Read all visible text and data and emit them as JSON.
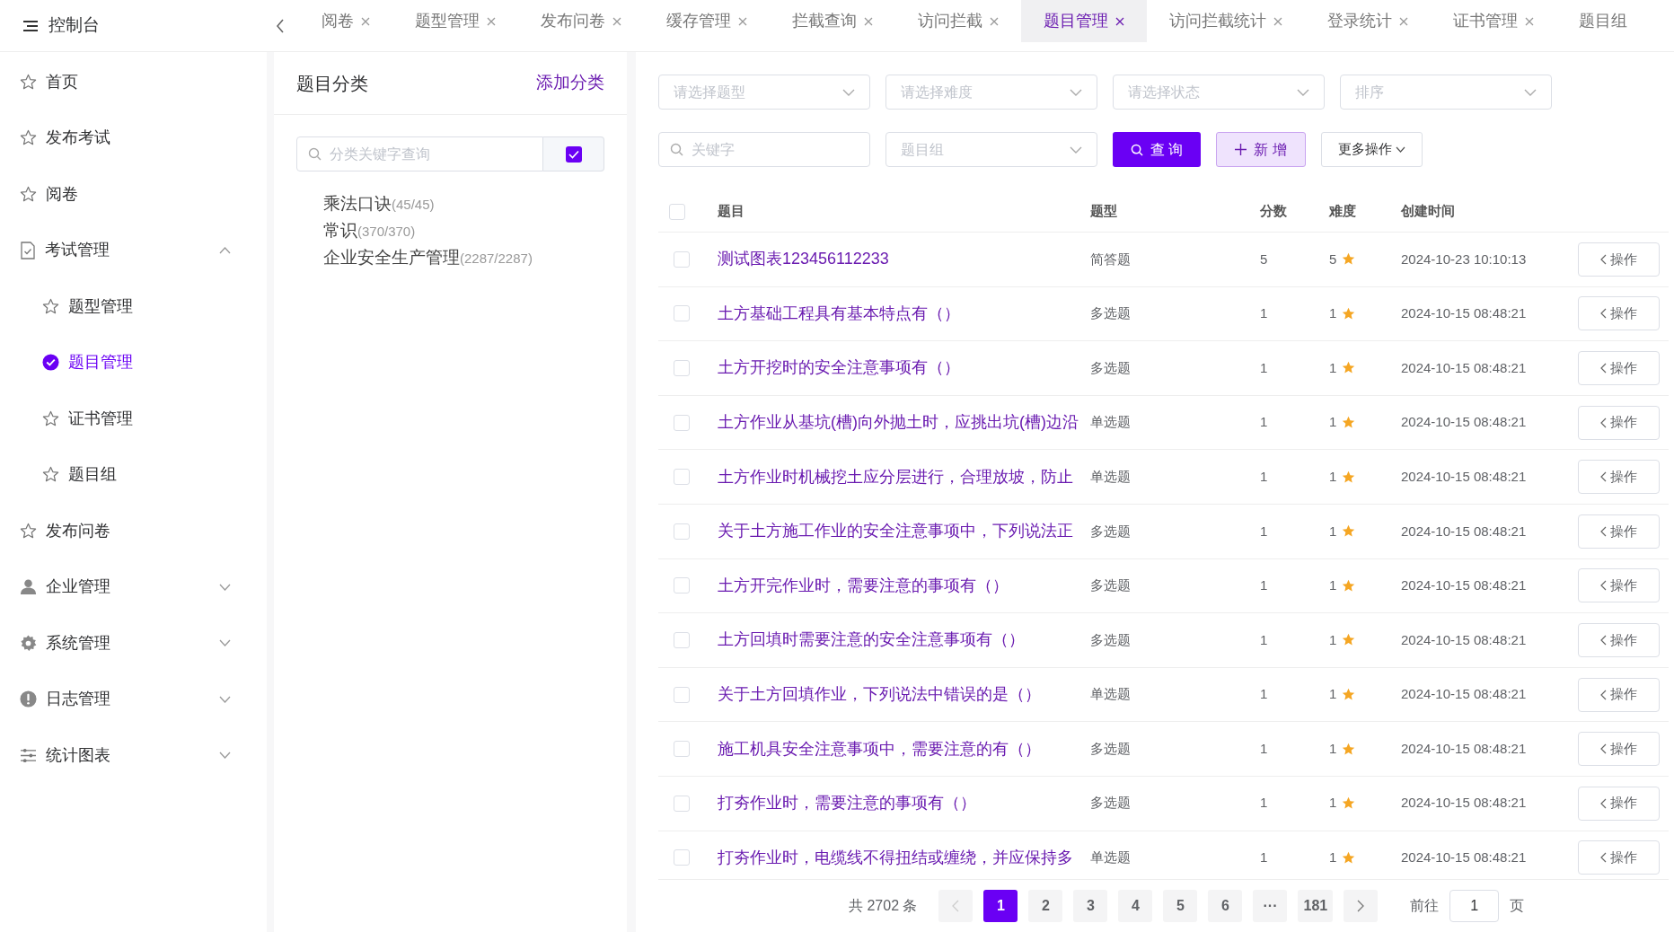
{
  "header": {
    "title": "控制台"
  },
  "tabs": [
    {
      "label": "阅卷",
      "selected": false,
      "closable": true
    },
    {
      "label": "题型管理",
      "selected": false,
      "closable": true
    },
    {
      "label": "发布问卷",
      "selected": false,
      "closable": true
    },
    {
      "label": "缓存管理",
      "selected": false,
      "closable": true
    },
    {
      "label": "拦截查询",
      "selected": false,
      "closable": true
    },
    {
      "label": "访问拦截",
      "selected": false,
      "closable": true
    },
    {
      "label": "题目管理",
      "selected": true,
      "closable": true
    },
    {
      "label": "访问拦截统计",
      "selected": false,
      "closable": true
    },
    {
      "label": "登录统计",
      "selected": false,
      "closable": true
    },
    {
      "label": "证书管理",
      "selected": false,
      "closable": true
    },
    {
      "label": "题目组",
      "selected": false,
      "closable": false
    }
  ],
  "sidebar": {
    "items": [
      {
        "kind": "link",
        "label": "首页",
        "selected": false
      },
      {
        "kind": "link",
        "label": "发布考试",
        "selected": false
      },
      {
        "kind": "link",
        "label": "阅卷",
        "selected": false
      },
      {
        "kind": "group",
        "label": "考试管理",
        "expanded": true,
        "children": [
          {
            "label": "题型管理",
            "selected": false
          },
          {
            "label": "题目管理",
            "selected": true
          },
          {
            "label": "证书管理",
            "selected": false
          },
          {
            "label": "题目组",
            "selected": false
          }
        ]
      },
      {
        "kind": "link",
        "label": "发布问卷",
        "selected": false
      },
      {
        "kind": "group",
        "label": "企业管理",
        "expanded": false
      },
      {
        "kind": "group",
        "label": "系统管理",
        "expanded": false
      },
      {
        "kind": "group",
        "label": "日志管理",
        "expanded": false
      },
      {
        "kind": "group",
        "label": "统计图表",
        "expanded": false
      }
    ]
  },
  "categories": {
    "title": "题目分类",
    "add_link": "添加分类",
    "search": {
      "placeholder": "分类关键字查询",
      "checked": true
    },
    "tree": [
      {
        "name": "乘法口诀",
        "count": "(45/45)"
      },
      {
        "name": "常识",
        "count": "(370/370)"
      },
      {
        "name": "企业安全生产管理",
        "count": "(2287/2287)"
      }
    ]
  },
  "filters": {
    "selects": [
      {
        "placeholder": "请选择题型"
      },
      {
        "placeholder": "请选择难度"
      },
      {
        "placeholder": "请选择状态"
      },
      {
        "placeholder": "排序"
      }
    ],
    "keyword": {
      "placeholder": "关键字"
    },
    "group_select": {
      "placeholder": "题目组"
    },
    "search_button": "查 询",
    "add_button": "新 增",
    "more_button": "更多操作"
  },
  "table": {
    "header_checked": false,
    "columns": [
      "题目",
      "题型",
      "分数",
      "难度",
      "创建时间"
    ],
    "rows": [
      {
        "checked": false,
        "title": "测试图表123456112233",
        "type": "简答题",
        "score": "5",
        "difficulty": "5",
        "created": "2024-10-23 10:10:13",
        "action": "操作"
      },
      {
        "checked": false,
        "title": "土方基础工程具有基本特点有（）",
        "type": "多选题",
        "score": "1",
        "difficulty": "1",
        "created": "2024-10-15 08:48:21",
        "action": "操作"
      },
      {
        "checked": false,
        "title": "土方开挖时的安全注意事项有（）",
        "type": "多选题",
        "score": "1",
        "difficulty": "1",
        "created": "2024-10-15 08:48:21",
        "action": "操作"
      },
      {
        "checked": false,
        "title": "土方作业从基坑(槽)向外抛土时，应挑出坑(槽)边沿",
        "type": "单选题",
        "score": "1",
        "difficulty": "1",
        "created": "2024-10-15 08:48:21",
        "action": "操作"
      },
      {
        "checked": false,
        "title": "土方作业时机械挖土应分层进行，合理放坡，防止",
        "type": "单选题",
        "score": "1",
        "difficulty": "1",
        "created": "2024-10-15 08:48:21",
        "action": "操作"
      },
      {
        "checked": false,
        "title": "关于土方施工作业的安全注意事项中，下列说法正",
        "type": "多选题",
        "score": "1",
        "difficulty": "1",
        "created": "2024-10-15 08:48:21",
        "action": "操作"
      },
      {
        "checked": false,
        "title": "土方开完作业时，需要注意的事项有（）",
        "type": "多选题",
        "score": "1",
        "difficulty": "1",
        "created": "2024-10-15 08:48:21",
        "action": "操作"
      },
      {
        "checked": false,
        "title": "土方回填时需要注意的安全注意事项有（）",
        "type": "多选题",
        "score": "1",
        "difficulty": "1",
        "created": "2024-10-15 08:48:21",
        "action": "操作"
      },
      {
        "checked": false,
        "title": "关于土方回填作业，下列说法中错误的是（）",
        "type": "单选题",
        "score": "1",
        "difficulty": "1",
        "created": "2024-10-15 08:48:21",
        "action": "操作"
      },
      {
        "checked": false,
        "title": "施工机具安全注意事项中，需要注意的有（）",
        "type": "多选题",
        "score": "1",
        "difficulty": "1",
        "created": "2024-10-15 08:48:21",
        "action": "操作"
      },
      {
        "checked": false,
        "title": "打夯作业时，需要注意的事项有（）",
        "type": "多选题",
        "score": "1",
        "difficulty": "1",
        "created": "2024-10-15 08:48:21",
        "action": "操作"
      },
      {
        "checked": false,
        "title": "打夯作业时，电缆线不得扭结或缠绕，并应保持多",
        "type": "单选题",
        "score": "1",
        "difficulty": "1",
        "created": "2024-10-15 08:48:21",
        "action": "操作"
      }
    ]
  },
  "pagination": {
    "total": "共 2702 条",
    "prev_disabled": true,
    "pages": [
      {
        "label": "1",
        "selected": true
      },
      {
        "label": "2",
        "selected": false
      },
      {
        "label": "3",
        "selected": false
      },
      {
        "label": "4",
        "selected": false
      },
      {
        "label": "5",
        "selected": false
      },
      {
        "label": "6",
        "selected": false
      },
      {
        "label": "···",
        "selected": false
      },
      {
        "label": "181",
        "selected": false
      }
    ],
    "goto_label": "前往",
    "goto_value": "1",
    "page_unit": "页"
  }
}
